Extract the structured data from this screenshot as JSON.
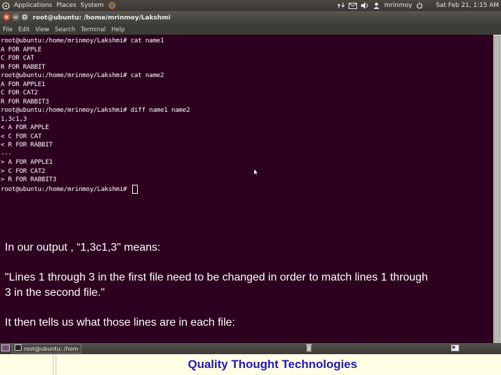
{
  "top_panel": {
    "menus": [
      "Applications",
      "Places",
      "System"
    ],
    "user": "mrinmoy",
    "clock": "Sat Feb 21,  1:15 AM"
  },
  "window": {
    "title": "root@ubuntu: /home/mrinmoy/Lakshmi",
    "menu": [
      "File",
      "Edit",
      "View",
      "Search",
      "Terminal",
      "Help"
    ]
  },
  "terminal": {
    "lines": [
      "root@ubuntu:/home/mrinmoy/Lakshmi# cat name1",
      "A FOR APPLE",
      "C FOR CAT",
      "R FOR RABBIT",
      "root@ubuntu:/home/mrinmoy/Lakshmi# cat name2",
      "A FOR APPLE1",
      "C FOR CAT2",
      "R FOR RABBIT3",
      "root@ubuntu:/home/mrinmoy/Lakshmi# diff name1 name2",
      "1,3c1,3",
      "< A FOR APPLE",
      "< C FOR CAT",
      "< R FOR RABBIT",
      "---",
      "> A FOR APPLE1",
      "> C FOR CAT2",
      "> R FOR RABBIT3",
      "root@ubuntu:/home/mrinmoy/Lakshmi# "
    ]
  },
  "overlay": {
    "line1": "In our output , “1,3c1,3\" means:",
    "line2a": "\"Lines 1 through 3 in the first file need to be changed in order to match lines 1 through",
    "line2b": "3 in the second file.\"",
    "line3": "It then tells us what those lines are in each file:"
  },
  "taskbar": {
    "task_label": "root@ubuntu: /home/..."
  },
  "footer": {
    "brand": "Quality Thought Technologies"
  },
  "colors": {
    "terminal_bg": "#2c001e",
    "brand_text": "#1c1ab8",
    "footer_bg": "#ffffe6"
  }
}
